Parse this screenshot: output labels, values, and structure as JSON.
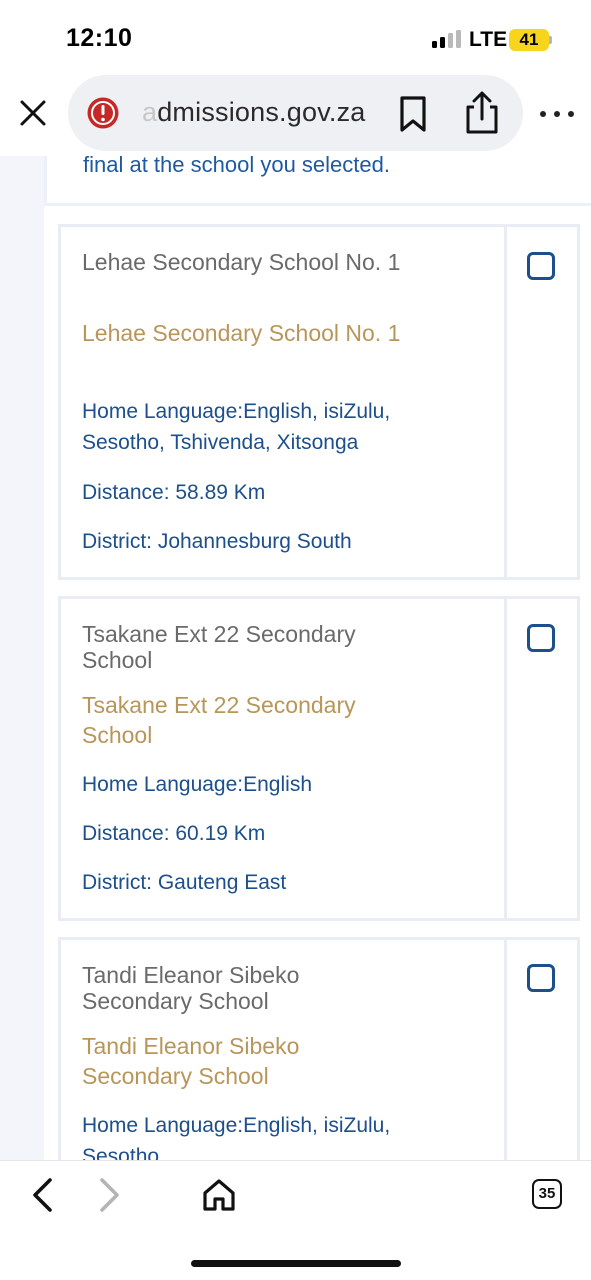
{
  "status_bar": {
    "time": "12:10",
    "network": "LTE",
    "battery": "41"
  },
  "browser": {
    "url_prefix": "a",
    "url_main": "dmissions.gov.za",
    "tab_count": "35",
    "icons": {
      "close": "close-icon",
      "security_warning": "warning-icon",
      "bookmark": "bookmark-icon",
      "share": "share-icon",
      "more": "more-icon",
      "back": "back-icon",
      "forward": "forward-icon",
      "home": "home-icon",
      "tabs": "tabs-icon"
    }
  },
  "page": {
    "previous_text": "final at the school you selected.",
    "schools": [
      {
        "label": "Lehae Secondary School No. 1",
        "name": "Lehae Secondary School No. 1",
        "home_language": "Home Language:English, isiZulu, Sesotho, Tshivenda, Xitsonga",
        "distance": "Distance: 58.89 Km",
        "district": "District: Johannesburg South"
      },
      {
        "label": "Tsakane Ext 22 Secondary School",
        "name": "Tsakane Ext 22 Secondary School",
        "home_language": "Home Language:English",
        "distance": "Distance: 60.19 Km",
        "district": "District: Gauteng East"
      },
      {
        "label": "Tandi Eleanor Sibeko Secondary School",
        "name": "Tandi Eleanor Sibeko Secondary School",
        "home_language": "Home Language:English, isiZulu, Sesotho",
        "distance": "",
        "district": ""
      }
    ]
  },
  "colors": {
    "label_grey": "#6a6a6a",
    "name_gold": "#b8965a",
    "info_blue": "#1c4f8c",
    "warning_red": "#c62828",
    "battery_yellow": "#f7d51d"
  }
}
